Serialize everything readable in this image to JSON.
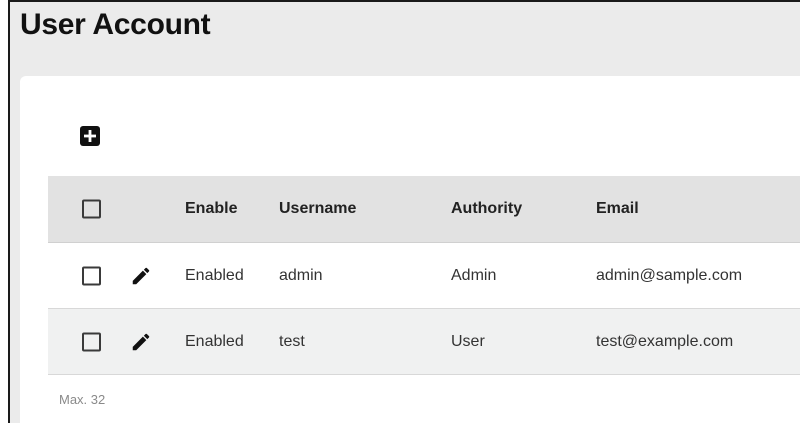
{
  "page": {
    "title": "User Account"
  },
  "toolbar": {
    "add_icon": "plus-square-icon"
  },
  "table": {
    "columns": [
      "",
      "",
      "Enable",
      "Username",
      "Authority",
      "Email"
    ],
    "rows": [
      {
        "enable": "Enabled",
        "username": "admin",
        "authority": "Admin",
        "email": "admin@sample.com"
      },
      {
        "enable": "Enabled",
        "username": "test",
        "authority": "User",
        "email": "test@example.com"
      }
    ],
    "edit_icon": "pencil-icon"
  },
  "footer": {
    "max_note": "Max. 32"
  },
  "colors": {
    "background": "#ebebeb",
    "header_row": "#e2e2e2",
    "alt_row": "#f0f1f1",
    "text": "#333333"
  }
}
